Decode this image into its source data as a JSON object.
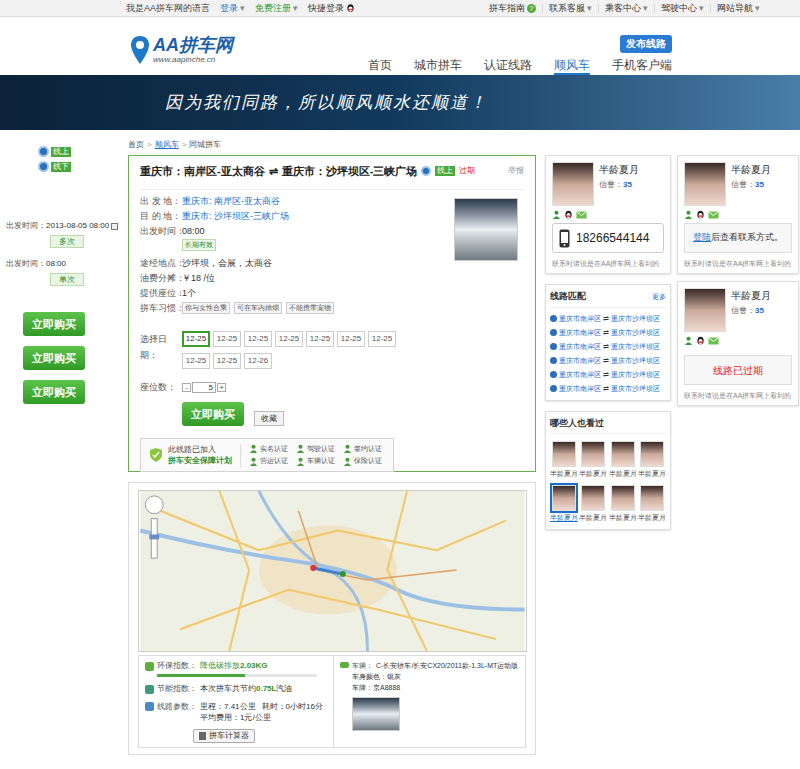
{
  "topbar": {
    "greeting": "我是AA拼车网的语言",
    "menu_arrow": "▾",
    "auth": [
      {
        "label": "登录",
        "color": "#1a6fc8",
        "kind": "menu"
      },
      {
        "label": "免费注册",
        "color": "#2e9a2e",
        "kind": "menu"
      },
      {
        "label": "快捷登录",
        "color": "#333333",
        "kind": "qq"
      }
    ],
    "links": [
      {
        "label": "拼车指南",
        "kind": "help",
        "icon": "?"
      },
      {
        "label": "联系客服",
        "kind": "menu",
        "icon": ""
      },
      {
        "label": "乘客中心",
        "kind": "menu",
        "icon": ""
      },
      {
        "label": "驾驶中心",
        "kind": "menu",
        "icon": ""
      },
      {
        "label": "网站导航",
        "kind": "menu",
        "icon": ""
      }
    ]
  },
  "header": {
    "logo": {
      "name": "AA拼车网",
      "url": "www.aapinche.cn"
    },
    "publish_button": "发布线路",
    "nav": [
      {
        "label": "首页",
        "selected": false
      },
      {
        "label": "城市拼车",
        "selected": false
      },
      {
        "label": "认证线路",
        "selected": false
      },
      {
        "label": "顺风车",
        "selected": true
      },
      {
        "label": "手机客户端",
        "selected": false
      }
    ]
  },
  "banner": {
    "slogan": "因为我们同路，所以顺风顺水还顺道！"
  },
  "breadcrumb": {
    "separator": ">",
    "items": [
      {
        "label": "首页",
        "kind": "plain"
      },
      {
        "label": "顺风车",
        "kind": "link"
      },
      {
        "label": "同城拼车",
        "kind": "plain"
      }
    ]
  },
  "side": {
    "badges": [
      "线上",
      "线下"
    ],
    "departures": [
      {
        "label": "出发时间：",
        "value": "2013-08-05 08:00",
        "tag": "多次"
      },
      {
        "label": "出发时间：",
        "value": "08:00",
        "tag": "单次"
      }
    ],
    "buy_buttons": [
      "立即购买",
      "立即购买",
      "立即购买"
    ]
  },
  "route": {
    "from": "重庆市：南岸区-亚太商谷",
    "arrow": "⇌",
    "to": "重庆市：沙坪坝区-三峡广场",
    "online": "线上",
    "expired": "过期",
    "report": "举报",
    "details": [
      {
        "label": "出 发 地：",
        "value": "重庆市: 南岸区-亚太商谷",
        "kind": "link",
        "badge": "",
        "chips": []
      },
      {
        "label": "目 的 地：",
        "value": "重庆市: 沙坪坝区-三峡广场",
        "kind": "link",
        "badge": "",
        "chips": []
      },
      {
        "label": "出发时间：",
        "value": "08:00",
        "kind": "badge",
        "badge": "长期有效",
        "chips": []
      },
      {
        "label": "途经地点：",
        "value": "沙坪坝，会展，太商谷",
        "kind": "text",
        "badge": "",
        "chips": []
      },
      {
        "label": "油费分摊：",
        "value": "￥18 /位",
        "kind": "text",
        "badge": "",
        "chips": []
      },
      {
        "label": "提供座位：",
        "value": "1个",
        "kind": "text",
        "badge": "",
        "chips": []
      },
      {
        "label": "拼车习惯：",
        "value": "",
        "kind": "chips",
        "badge": "",
        "chips": [
          "你与女性合乘",
          "可在车内抽烟",
          "不能携带宠物"
        ]
      }
    ],
    "dates": {
      "label": "选择日期：",
      "items": [
        {
          "text": "12-25",
          "selected": true
        },
        {
          "text": "12-25",
          "selected": false
        },
        {
          "text": "12-25",
          "selected": false
        },
        {
          "text": "12-25",
          "selected": false
        },
        {
          "text": "12-25",
          "selected": false
        },
        {
          "text": "12-25",
          "selected": false
        },
        {
          "text": "12-25",
          "selected": false
        },
        {
          "text": "12-25",
          "selected": false
        },
        {
          "text": "12-25",
          "selected": false
        },
        {
          "text": "12-26",
          "selected": false
        }
      ]
    },
    "seats": {
      "label": "座位数：",
      "minus": "-",
      "value": "5",
      "plus": "+"
    },
    "buy": "立即购买",
    "favorite": "收藏",
    "safety": {
      "line1": "此线路已加入",
      "line2": "拼车安全保障计划",
      "certs": [
        "实名认证",
        "驾驶认证",
        "签约认证",
        "营运认证",
        "车辆认证",
        "保险认证"
      ]
    }
  },
  "stats": {
    "eco": {
      "label": "环保指数：",
      "prefix": "降低碳排放",
      "value": "2.03KG",
      "level": 0.55
    },
    "energy": {
      "label": "节能指数：",
      "prefix": "本次拼车共节约",
      "value": "0.75L",
      "suffix": "汽油"
    },
    "params": {
      "label": "线路参数：",
      "distance": "里程：7.41公里",
      "time": "耗时：0小时16分",
      "avg": "平均费用：1元/公里"
    },
    "calculator": "拼车计算器",
    "vehicle": {
      "label": "车辆：",
      "model": "C-长安轿车/长安CX20/2011款-1.3L-MT运动版",
      "body_color": "车身颜色：银灰",
      "plate": "车牌：京A8888"
    }
  },
  "owners": [
    {
      "name": "半龄夏月",
      "credit_label": "信誉：",
      "credit": "35",
      "kind": "phone",
      "link": "",
      "contact": "18266544144",
      "note": "联系时请说是在AA拼车网上看到的"
    },
    {
      "name": "半龄夏月",
      "credit_label": "信誉：",
      "credit": "35",
      "kind": "login",
      "link": "登陆",
      "contact": "后查看联系方式。",
      "note": "联系时请说是在AA拼车网上看到的"
    },
    {
      "name": "半龄夏月",
      "credit_label": "信誉：",
      "credit": "35",
      "kind": "expired",
      "link": "",
      "contact": "线路已过期",
      "note": "联系时请说是在AA拼车网上看到的"
    }
  ],
  "matches": {
    "title": "线路匹配",
    "more": "更多",
    "arrow": "⇌",
    "items": [
      {
        "from": "重庆市南岸区",
        "to": "重庆市沙坪坝区"
      },
      {
        "from": "重庆市南岸区",
        "to": "重庆市沙坪坝区"
      },
      {
        "from": "重庆市南岸区",
        "to": "重庆市沙坪坝区"
      },
      {
        "from": "重庆市南岸区",
        "to": "重庆市沙坪坝区"
      },
      {
        "from": "重庆市南岸区",
        "to": "重庆市沙坪坝区"
      },
      {
        "from": "重庆市南岸区",
        "to": "重庆市沙坪坝区"
      }
    ]
  },
  "viewers": {
    "title": "哪些人也看过",
    "people": [
      {
        "name": "半龄夏月",
        "selected": false
      },
      {
        "name": "半龄夏月",
        "selected": false
      },
      {
        "name": "半龄夏月",
        "selected": false
      },
      {
        "name": "半龄夏月",
        "selected": false
      },
      {
        "name": "半龄夏月",
        "selected": true
      },
      {
        "name": "半龄夏月",
        "selected": false
      },
      {
        "name": "半龄夏月",
        "selected": false
      },
      {
        "name": "半龄夏月",
        "selected": false
      }
    ]
  }
}
